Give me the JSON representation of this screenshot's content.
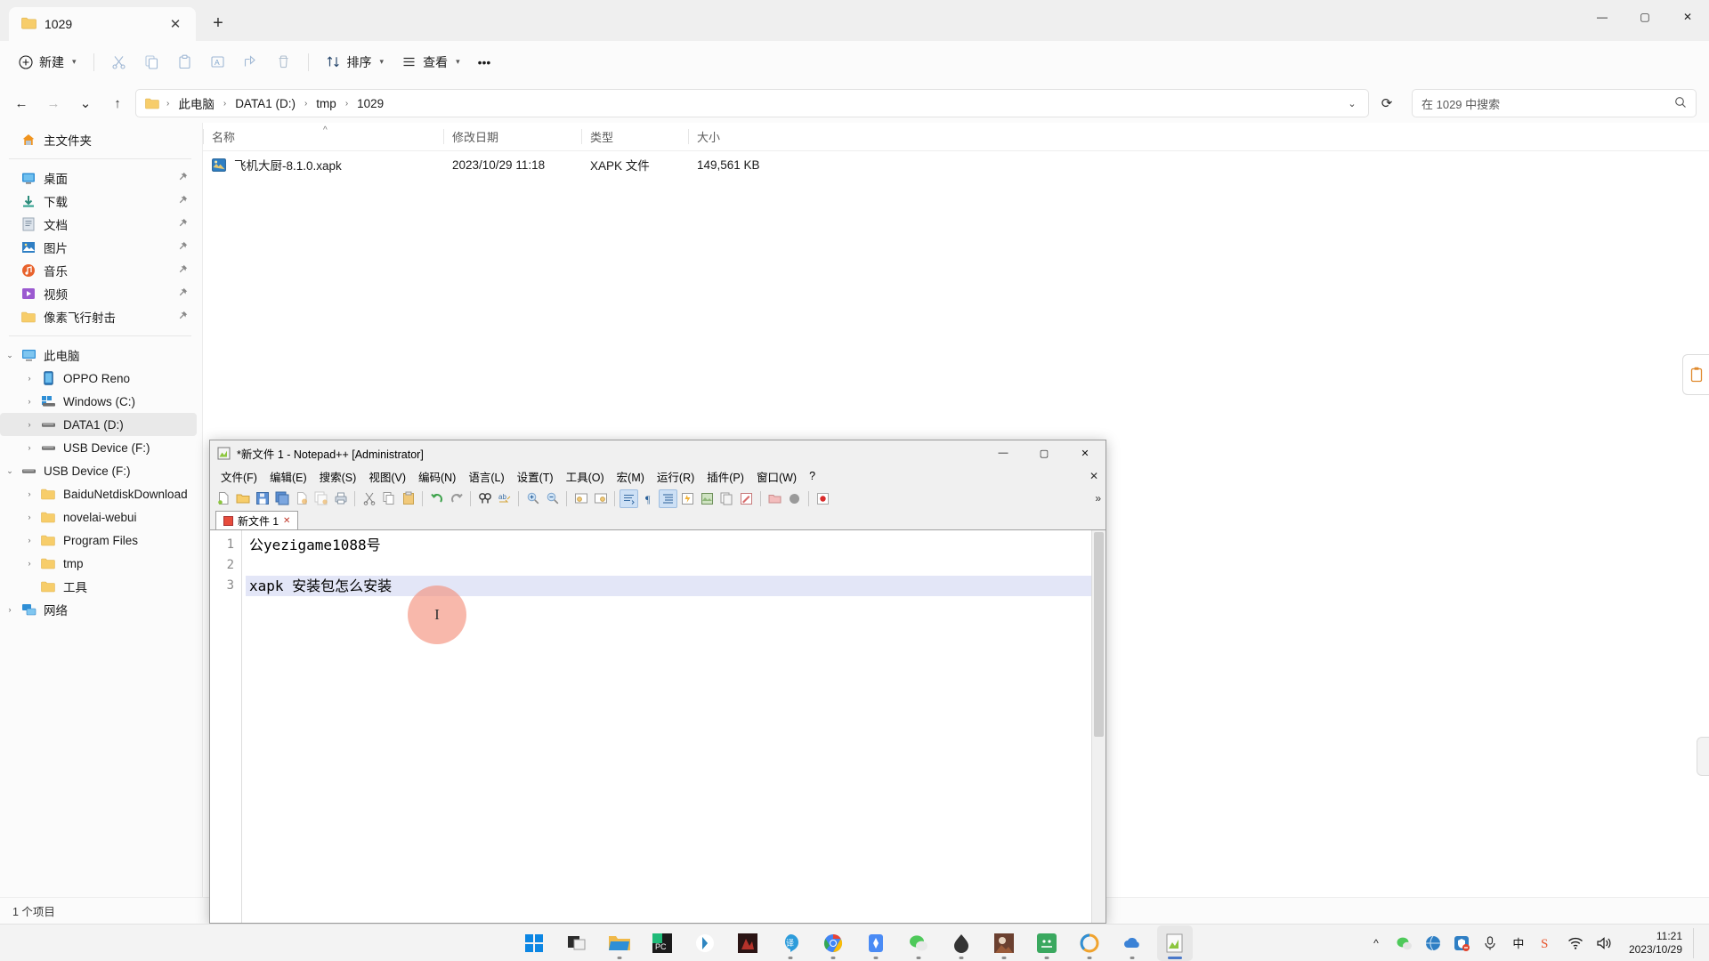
{
  "explorer": {
    "tab": {
      "title": "1029",
      "icon": "folder-icon",
      "close_label": "✕",
      "new_tab_label": "+"
    },
    "window_controls": {
      "minimize": "—",
      "maximize": "▢",
      "close": "✕"
    },
    "commandbar": {
      "new_label": "新建",
      "sort_label": "排序",
      "view_label": "查看",
      "more_label": "•••",
      "icons": [
        "cut-icon",
        "copy-icon",
        "paste-icon",
        "rename-icon",
        "share-icon",
        "delete-icon"
      ]
    },
    "address": {
      "crumbs": [
        "此电脑",
        "DATA1 (D:)",
        "tmp",
        "1029"
      ],
      "separator": "›",
      "dropdown": "⌄",
      "refresh": "⟳"
    },
    "search": {
      "placeholder": "在 1029 中搜索",
      "icon": "search-icon"
    },
    "nav": {
      "home": {
        "label": "主文件夹",
        "icon": "home-icon"
      },
      "quick": [
        {
          "label": "桌面",
          "icon": "desktop-icon",
          "pinned": true
        },
        {
          "label": "下载",
          "icon": "download-icon",
          "pinned": true
        },
        {
          "label": "文档",
          "icon": "documents-icon",
          "pinned": true
        },
        {
          "label": "图片",
          "icon": "pictures-icon",
          "pinned": true
        },
        {
          "label": "音乐",
          "icon": "music-icon",
          "pinned": true
        },
        {
          "label": "视频",
          "icon": "videos-icon",
          "pinned": true
        },
        {
          "label": "像素飞行射击",
          "icon": "folder-icon",
          "pinned": true
        }
      ],
      "tree": [
        {
          "label": "此电脑",
          "icon": "pc-icon",
          "chevron": "⌄",
          "indent": 0,
          "selected": false
        },
        {
          "label": "OPPO Reno",
          "icon": "phone-icon",
          "chevron": "›",
          "indent": 1,
          "selected": false
        },
        {
          "label": "Windows (C:)",
          "icon": "windows-drive-icon",
          "chevron": "›",
          "indent": 1,
          "selected": false
        },
        {
          "label": "DATA1 (D:)",
          "icon": "drive-icon",
          "chevron": "›",
          "indent": 1,
          "selected": true
        },
        {
          "label": "USB Device (F:)",
          "icon": "drive-icon",
          "chevron": "›",
          "indent": 1,
          "selected": false
        },
        {
          "label": "USB Device (F:)",
          "icon": "drive-icon",
          "chevron": "⌄",
          "indent": 0,
          "selected": false
        },
        {
          "label": "BaiduNetdiskDownload",
          "icon": "folder-icon",
          "chevron": "›",
          "indent": 1,
          "selected": false
        },
        {
          "label": "novelai-webui",
          "icon": "folder-icon",
          "chevron": "›",
          "indent": 1,
          "selected": false
        },
        {
          "label": "Program Files",
          "icon": "folder-icon",
          "chevron": "›",
          "indent": 1,
          "selected": false
        },
        {
          "label": "tmp",
          "icon": "folder-icon",
          "chevron": "›",
          "indent": 1,
          "selected": false
        },
        {
          "label": "工具",
          "icon": "folder-icon",
          "chevron": "",
          "indent": 1,
          "selected": false
        },
        {
          "label": "网络",
          "icon": "network-icon",
          "chevron": "›",
          "indent": 0,
          "selected": false
        }
      ]
    },
    "columns": [
      {
        "key": "name",
        "label": "名称"
      },
      {
        "key": "date",
        "label": "修改日期"
      },
      {
        "key": "type",
        "label": "类型"
      },
      {
        "key": "size",
        "label": "大小"
      }
    ],
    "sort_indicator": "^",
    "files": [
      {
        "name": "飞机大厨-8.1.0.xapk",
        "date": "2023/10/29 11:18",
        "type": "XAPK 文件",
        "size": "149,561 KB",
        "icon": "xapk-file-icon"
      }
    ],
    "status": "1 个项目"
  },
  "notepad": {
    "title": "*新文件 1 - Notepad++ [Administrator]",
    "window_controls": {
      "minimize": "—",
      "maximize": "▢",
      "close": "✕"
    },
    "menu": [
      "文件(F)",
      "编辑(E)",
      "搜索(S)",
      "视图(V)",
      "编码(N)",
      "语言(L)",
      "设置(T)",
      "工具(O)",
      "宏(M)",
      "运行(R)",
      "插件(P)",
      "窗口(W)",
      "?"
    ],
    "menu_close": "✕",
    "toolbar_overflow": "»",
    "tab": {
      "label": "新文件 1",
      "close": "✕"
    },
    "lines": [
      {
        "no": "1",
        "text": "公yezigame1088号",
        "highlight": false
      },
      {
        "no": "2",
        "text": "",
        "highlight": false
      },
      {
        "no": "3",
        "text": "xapk 安装包怎么安装",
        "highlight": true
      }
    ],
    "cursor_glyph": "I"
  },
  "taskbar": {
    "apps": [
      {
        "name": "start-button",
        "running": false
      },
      {
        "name": "task-view-button",
        "running": false
      },
      {
        "name": "file-explorer-taskbar-icon",
        "running": true
      },
      {
        "name": "pycharm-taskbar-icon",
        "running": true
      },
      {
        "name": "android-studio-taskbar-icon",
        "running": false
      },
      {
        "name": "game-taskbar-icon",
        "running": false
      },
      {
        "name": "translate-taskbar-icon",
        "running": true
      },
      {
        "name": "chrome-taskbar-icon",
        "running": true
      },
      {
        "name": "notes-taskbar-icon",
        "running": true
      },
      {
        "name": "wechat-taskbar-icon",
        "running": true
      },
      {
        "name": "ink-taskbar-icon",
        "running": true
      },
      {
        "name": "artwork-taskbar-icon",
        "running": true
      },
      {
        "name": "mumu-taskbar-icon",
        "running": true
      },
      {
        "name": "browser-taskbar-icon",
        "running": true
      },
      {
        "name": "cloud-taskbar-icon",
        "running": true
      },
      {
        "name": "notepadpp-taskbar-icon",
        "running": true,
        "active": true
      }
    ],
    "tray": {
      "expand": "^",
      "icons": [
        "wechat-tray-icon",
        "globe-tray-icon",
        "security-tray-icon",
        "microphone-tray-icon",
        "ime-tray-icon",
        "sogou-tray-icon",
        "wifi-tray-icon",
        "volume-tray-icon"
      ],
      "ime_label": "中",
      "wifi_glyph": "⌃",
      "volume_glyph": "🔊"
    },
    "clock": {
      "time": "11:21",
      "date": "2023/10/29"
    }
  }
}
